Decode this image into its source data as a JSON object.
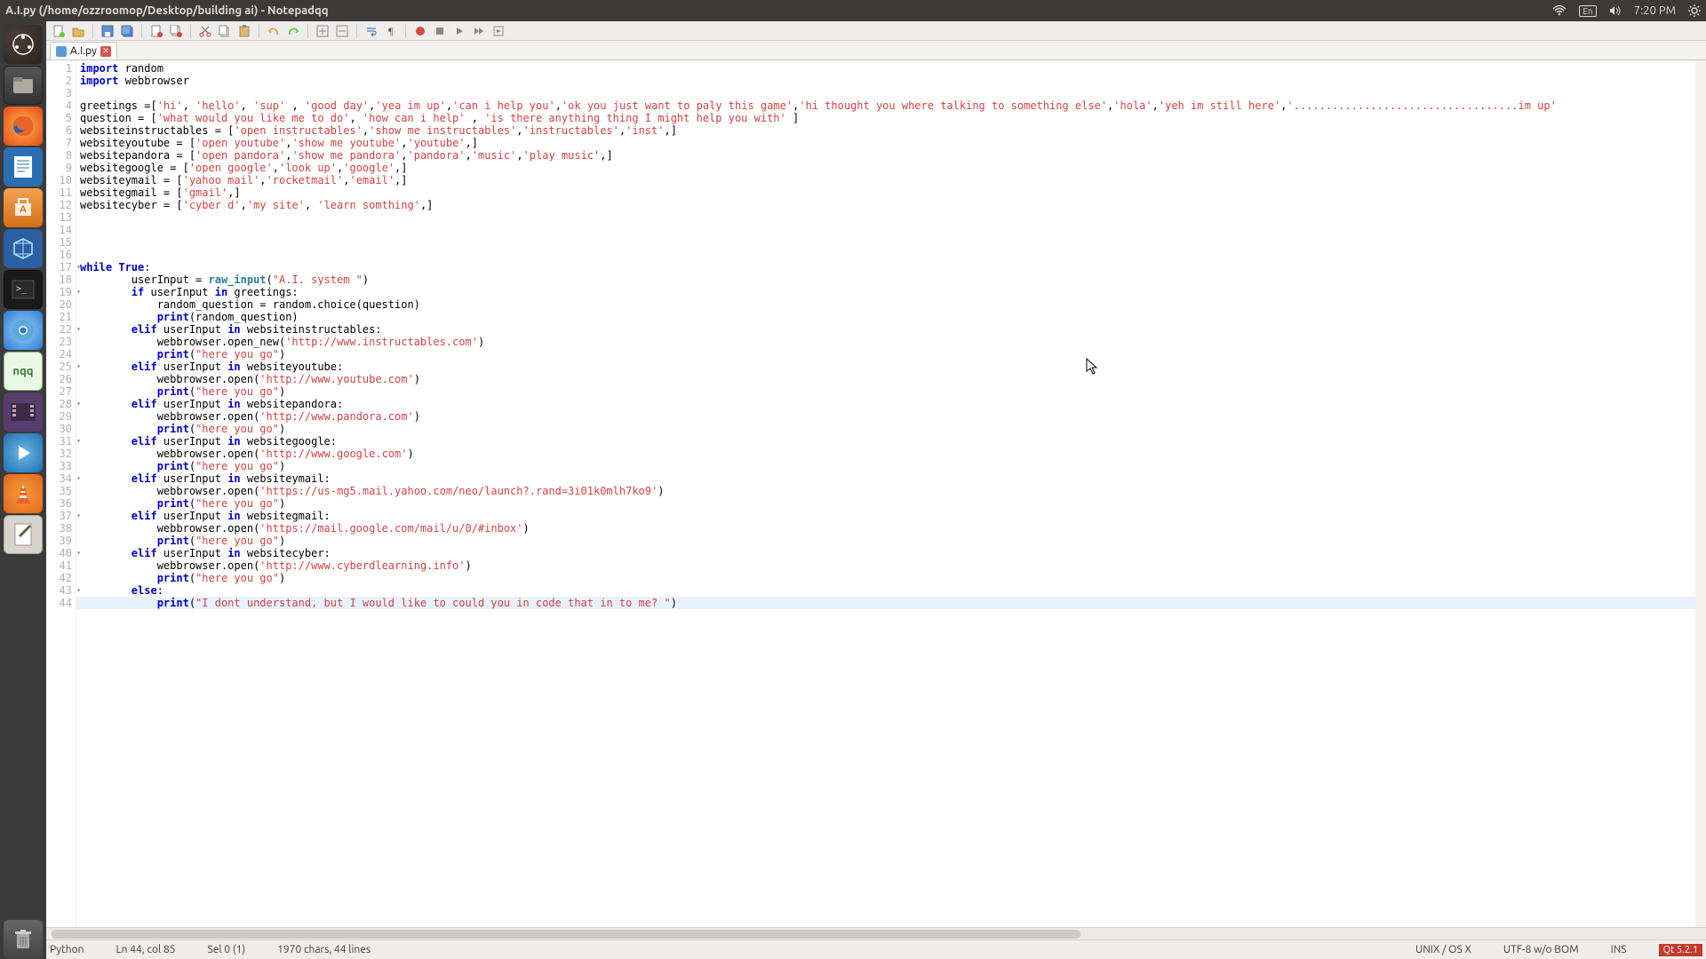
{
  "window": {
    "title": "A.I.py (/home/ozzroomop/Desktop/building ai) - Notepadqq"
  },
  "menubar": {
    "time": "7:20 PM",
    "lang": "En"
  },
  "tab": {
    "label": "A.I.py"
  },
  "status": {
    "language": "Python",
    "position": "Ln 44, col 85",
    "selection": "Sel 0 (1)",
    "chars": "1970 chars, 44 lines",
    "eol": "UNIX / OS X",
    "encoding": "UTF-8 w/o BOM",
    "mode": "INS",
    "qt": "Qt 5.2.1"
  },
  "code": {
    "lines": [
      {
        "n": 1,
        "t": "plain",
        "seg": [
          [
            "kw",
            "import"
          ],
          [
            "nm",
            " random"
          ]
        ]
      },
      {
        "n": 2,
        "t": "plain",
        "seg": [
          [
            "kw",
            "import"
          ],
          [
            "nm",
            " webbrowser"
          ]
        ]
      },
      {
        "n": 3,
        "t": "plain",
        "seg": []
      },
      {
        "n": 4,
        "t": "plain",
        "seg": [
          [
            "nm",
            "greetings =["
          ],
          [
            "str",
            "'hi'"
          ],
          [
            "nm",
            ", "
          ],
          [
            "str",
            "'hello'"
          ],
          [
            "nm",
            ", "
          ],
          [
            "str",
            "'sup'"
          ],
          [
            "nm",
            " , "
          ],
          [
            "str",
            "'good day'"
          ],
          [
            "nm",
            ","
          ],
          [
            "str",
            "'yea im up'"
          ],
          [
            "nm",
            ","
          ],
          [
            "str",
            "'can i help you'"
          ],
          [
            "nm",
            ","
          ],
          [
            "str",
            "'ok you just want to paly this game'"
          ],
          [
            "nm",
            ","
          ],
          [
            "str",
            "'hi thought you where talking to something else'"
          ],
          [
            "nm",
            ","
          ],
          [
            "str",
            "'hola'"
          ],
          [
            "nm",
            ","
          ],
          [
            "str",
            "'yeh im still here'"
          ],
          [
            "nm",
            ","
          ],
          [
            "str",
            "'...................................im up'"
          ]
        ]
      },
      {
        "n": 5,
        "t": "plain",
        "seg": [
          [
            "nm",
            "question = ["
          ],
          [
            "str",
            "'what would you like me to do'"
          ],
          [
            "nm",
            ", "
          ],
          [
            "str",
            "'how can i help'"
          ],
          [
            "nm",
            " , "
          ],
          [
            "str",
            "'is there anything thing I might help you with'"
          ],
          [
            "nm",
            " ]"
          ]
        ]
      },
      {
        "n": 6,
        "t": "plain",
        "seg": [
          [
            "nm",
            "websiteinstructables = ["
          ],
          [
            "str",
            "'open instructables'"
          ],
          [
            "nm",
            ","
          ],
          [
            "str",
            "'show me instructables'"
          ],
          [
            "nm",
            ","
          ],
          [
            "str",
            "'instructables'"
          ],
          [
            "nm",
            ","
          ],
          [
            "str",
            "'inst'"
          ],
          [
            "nm",
            ",]"
          ]
        ]
      },
      {
        "n": 7,
        "t": "plain",
        "seg": [
          [
            "nm",
            "websiteyoutube = ["
          ],
          [
            "str",
            "'open youtube'"
          ],
          [
            "nm",
            ","
          ],
          [
            "str",
            "'show me youtube'"
          ],
          [
            "nm",
            ","
          ],
          [
            "str",
            "'youtube'"
          ],
          [
            "nm",
            ",]"
          ]
        ]
      },
      {
        "n": 8,
        "t": "plain",
        "seg": [
          [
            "nm",
            "websitepandora = ["
          ],
          [
            "str",
            "'open pandora'"
          ],
          [
            "nm",
            ","
          ],
          [
            "str",
            "'show me pandora'"
          ],
          [
            "nm",
            ","
          ],
          [
            "str",
            "'pandora'"
          ],
          [
            "nm",
            ","
          ],
          [
            "str",
            "'music'"
          ],
          [
            "nm",
            ","
          ],
          [
            "str",
            "'play music'"
          ],
          [
            "nm",
            ",]"
          ]
        ]
      },
      {
        "n": 9,
        "t": "plain",
        "seg": [
          [
            "nm",
            "websitegoogle = ["
          ],
          [
            "str",
            "'open google'"
          ],
          [
            "nm",
            ","
          ],
          [
            "str",
            "'look up'"
          ],
          [
            "nm",
            ","
          ],
          [
            "str",
            "'google'"
          ],
          [
            "nm",
            ",]"
          ]
        ]
      },
      {
        "n": 10,
        "t": "plain",
        "seg": [
          [
            "nm",
            "websiteymail = ["
          ],
          [
            "str",
            "'yahoo mail'"
          ],
          [
            "nm",
            ","
          ],
          [
            "str",
            "'rocketmail'"
          ],
          [
            "nm",
            ","
          ],
          [
            "str",
            "'email'"
          ],
          [
            "nm",
            ",]"
          ]
        ]
      },
      {
        "n": 11,
        "t": "plain",
        "seg": [
          [
            "nm",
            "websitegmail = ["
          ],
          [
            "str",
            "'gmail'"
          ],
          [
            "nm",
            ",]"
          ]
        ]
      },
      {
        "n": 12,
        "t": "plain",
        "seg": [
          [
            "nm",
            "websitecyber = ["
          ],
          [
            "str",
            "'cyber d'"
          ],
          [
            "nm",
            ","
          ],
          [
            "str",
            "'my site'"
          ],
          [
            "nm",
            ", "
          ],
          [
            "str",
            "'learn somthing'"
          ],
          [
            "nm",
            ",]"
          ]
        ]
      },
      {
        "n": 13,
        "t": "plain",
        "seg": []
      },
      {
        "n": 14,
        "t": "plain",
        "seg": []
      },
      {
        "n": 15,
        "t": "plain",
        "seg": []
      },
      {
        "n": 16,
        "t": "plain",
        "seg": []
      },
      {
        "n": 17,
        "t": "fold",
        "seg": [
          [
            "kw",
            "while"
          ],
          [
            "nm",
            " "
          ],
          [
            "kw",
            "True"
          ],
          [
            "nm",
            ":"
          ]
        ]
      },
      {
        "n": 18,
        "t": "plain",
        "seg": [
          [
            "nm",
            "        userInput = "
          ],
          [
            "ri",
            "raw_input"
          ],
          [
            "nm",
            "("
          ],
          [
            "str",
            "\"A.I. system \""
          ],
          [
            "nm",
            ")"
          ]
        ]
      },
      {
        "n": 19,
        "t": "fold",
        "seg": [
          [
            "nm",
            "        "
          ],
          [
            "kw",
            "if"
          ],
          [
            "nm",
            " userInput "
          ],
          [
            "kw",
            "in"
          ],
          [
            "nm",
            " greetings:"
          ]
        ]
      },
      {
        "n": 20,
        "t": "plain",
        "seg": [
          [
            "nm",
            "            random_question = random.choice(question)"
          ]
        ]
      },
      {
        "n": 21,
        "t": "plain",
        "seg": [
          [
            "nm",
            "            "
          ],
          [
            "kw",
            "print"
          ],
          [
            "nm",
            "(random_question)"
          ]
        ]
      },
      {
        "n": 22,
        "t": "fold",
        "seg": [
          [
            "nm",
            "        "
          ],
          [
            "kw",
            "elif"
          ],
          [
            "nm",
            " userInput "
          ],
          [
            "kw",
            "in"
          ],
          [
            "nm",
            " websiteinstructables:"
          ]
        ]
      },
      {
        "n": 23,
        "t": "plain",
        "seg": [
          [
            "nm",
            "            webbrowser.open_new("
          ],
          [
            "str",
            "'http://www.instructables.com'"
          ],
          [
            "nm",
            ")"
          ]
        ]
      },
      {
        "n": 24,
        "t": "plain",
        "seg": [
          [
            "nm",
            "            "
          ],
          [
            "kw",
            "print"
          ],
          [
            "nm",
            "("
          ],
          [
            "str",
            "\"here you go\""
          ],
          [
            "nm",
            ")"
          ]
        ]
      },
      {
        "n": 25,
        "t": "fold",
        "seg": [
          [
            "nm",
            "        "
          ],
          [
            "kw",
            "elif"
          ],
          [
            "nm",
            " userInput "
          ],
          [
            "kw",
            "in"
          ],
          [
            "nm",
            " websiteyoutube:"
          ]
        ]
      },
      {
        "n": 26,
        "t": "plain",
        "seg": [
          [
            "nm",
            "            webbrowser.open("
          ],
          [
            "str",
            "'http://www.youtube.com'"
          ],
          [
            "nm",
            ")"
          ]
        ]
      },
      {
        "n": 27,
        "t": "plain",
        "seg": [
          [
            "nm",
            "            "
          ],
          [
            "kw",
            "print"
          ],
          [
            "nm",
            "("
          ],
          [
            "str",
            "\"here you go\""
          ],
          [
            "nm",
            ")"
          ]
        ]
      },
      {
        "n": 28,
        "t": "fold",
        "seg": [
          [
            "nm",
            "        "
          ],
          [
            "kw",
            "elif"
          ],
          [
            "nm",
            " userInput "
          ],
          [
            "kw",
            "in"
          ],
          [
            "nm",
            " websitepandora:"
          ]
        ]
      },
      {
        "n": 29,
        "t": "plain",
        "seg": [
          [
            "nm",
            "            webbrowser.open("
          ],
          [
            "str",
            "'http://www.pandora.com'"
          ],
          [
            "nm",
            ")"
          ]
        ]
      },
      {
        "n": 30,
        "t": "plain",
        "seg": [
          [
            "nm",
            "            "
          ],
          [
            "kw",
            "print"
          ],
          [
            "nm",
            "("
          ],
          [
            "str",
            "\"here you go\""
          ],
          [
            "nm",
            ")"
          ]
        ]
      },
      {
        "n": 31,
        "t": "fold",
        "seg": [
          [
            "nm",
            "        "
          ],
          [
            "kw",
            "elif"
          ],
          [
            "nm",
            " userInput "
          ],
          [
            "kw",
            "in"
          ],
          [
            "nm",
            " websitegoogle:"
          ]
        ]
      },
      {
        "n": 32,
        "t": "plain",
        "seg": [
          [
            "nm",
            "            webbrowser.open("
          ],
          [
            "str",
            "'http://www.google.com'"
          ],
          [
            "nm",
            ")"
          ]
        ]
      },
      {
        "n": 33,
        "t": "plain",
        "seg": [
          [
            "nm",
            "            "
          ],
          [
            "kw",
            "print"
          ],
          [
            "nm",
            "("
          ],
          [
            "str",
            "\"here you go\""
          ],
          [
            "nm",
            ")"
          ]
        ]
      },
      {
        "n": 34,
        "t": "fold",
        "seg": [
          [
            "nm",
            "        "
          ],
          [
            "kw",
            "elif"
          ],
          [
            "nm",
            " userInput "
          ],
          [
            "kw",
            "in"
          ],
          [
            "nm",
            " websiteymail:"
          ]
        ]
      },
      {
        "n": 35,
        "t": "plain",
        "seg": [
          [
            "nm",
            "            webbrowser.open("
          ],
          [
            "str",
            "'https://us-mg5.mail.yahoo.com/neo/launch?.rand=3i01k0mlh7ko9'"
          ],
          [
            "nm",
            ")"
          ]
        ]
      },
      {
        "n": 36,
        "t": "plain",
        "seg": [
          [
            "nm",
            "            "
          ],
          [
            "kw",
            "print"
          ],
          [
            "nm",
            "("
          ],
          [
            "str",
            "\"here you go\""
          ],
          [
            "nm",
            ")"
          ]
        ]
      },
      {
        "n": 37,
        "t": "fold",
        "seg": [
          [
            "nm",
            "        "
          ],
          [
            "kw",
            "elif"
          ],
          [
            "nm",
            " userInput "
          ],
          [
            "kw",
            "in"
          ],
          [
            "nm",
            " websitegmail:"
          ]
        ]
      },
      {
        "n": 38,
        "t": "plain",
        "seg": [
          [
            "nm",
            "            webbrowser.open("
          ],
          [
            "str",
            "'https://mail.google.com/mail/u/0/#inbox'"
          ],
          [
            "nm",
            ")"
          ]
        ]
      },
      {
        "n": 39,
        "t": "plain",
        "seg": [
          [
            "nm",
            "            "
          ],
          [
            "kw",
            "print"
          ],
          [
            "nm",
            "("
          ],
          [
            "str",
            "\"here you go\""
          ],
          [
            "nm",
            ")"
          ]
        ]
      },
      {
        "n": 40,
        "t": "fold",
        "seg": [
          [
            "nm",
            "        "
          ],
          [
            "kw",
            "elif"
          ],
          [
            "nm",
            " userInput "
          ],
          [
            "kw",
            "in"
          ],
          [
            "nm",
            " websitecyber:"
          ]
        ]
      },
      {
        "n": 41,
        "t": "plain",
        "seg": [
          [
            "nm",
            "            webbrowser.open("
          ],
          [
            "str",
            "'http://www.cyberdlearning.info'"
          ],
          [
            "nm",
            ")"
          ]
        ]
      },
      {
        "n": 42,
        "t": "plain",
        "seg": [
          [
            "nm",
            "            "
          ],
          [
            "kw",
            "print"
          ],
          [
            "nm",
            "("
          ],
          [
            "str",
            "\"here you go\""
          ],
          [
            "nm",
            ")"
          ]
        ]
      },
      {
        "n": 43,
        "t": "fold",
        "seg": [
          [
            "nm",
            "        "
          ],
          [
            "kw",
            "else"
          ],
          [
            "nm",
            ":"
          ]
        ]
      },
      {
        "n": 44,
        "t": "cur",
        "seg": [
          [
            "nm",
            "            "
          ],
          [
            "kw",
            "print"
          ],
          [
            "nm",
            "("
          ],
          [
            "str",
            "\"I dont understand, but I would like to could you in code that in to me? \""
          ],
          [
            "nm",
            ")"
          ]
        ]
      }
    ]
  }
}
